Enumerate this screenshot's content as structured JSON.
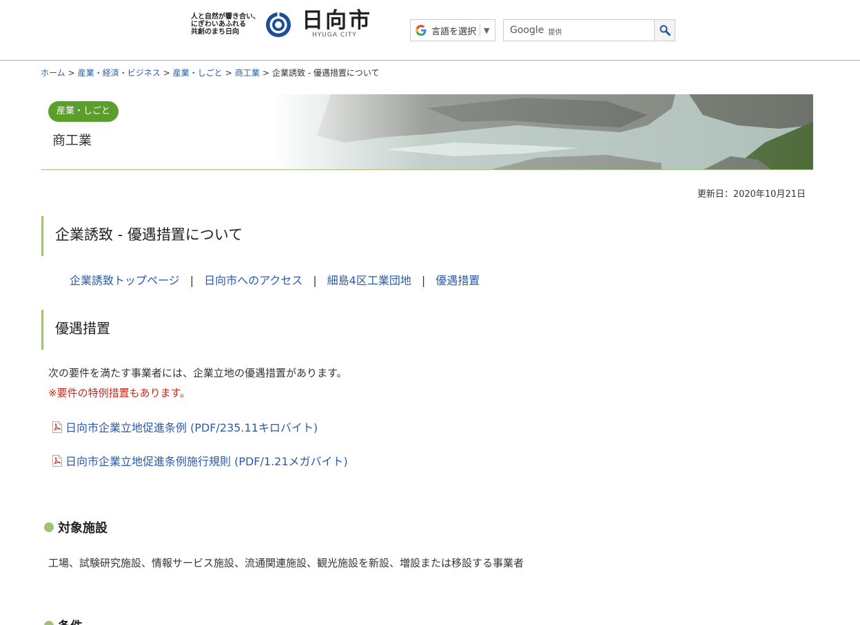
{
  "header": {
    "tagline": "人と自然が響き合い、\nにぎわいあふれる\n共創のまち日向",
    "logo_text": "日向市",
    "logo_sub": "HYUGA CITY",
    "translate_label": "言語を選択",
    "translate_caret": "▼",
    "search_brand": "Google",
    "search_provided": "提供"
  },
  "breadcrumb": {
    "items": [
      "ホーム",
      "産業・経済・ビジネス",
      "産業・しごと",
      "商工業"
    ],
    "current": "企業誘致 - 優遇措置について",
    "separator": ">"
  },
  "banner": {
    "category": "産業・しごと",
    "title": "商工業"
  },
  "updated": "更新日：2020年10月21日",
  "page_title": "企業誘致 - 優遇措置について",
  "subnav": {
    "items": [
      "企業誘致トップページ",
      "日向市へのアクセス",
      "細島4区工業団地",
      "優遇措置"
    ],
    "separator": "|"
  },
  "section_title": "優遇措置",
  "intro": "次の要件を満たす事業者には、企業立地の優遇措置があります。",
  "note": "※要件の特例措置もあります。",
  "pdf_links": [
    "日向市企業立地促進条例 (PDF/235.11キロバイト)",
    "日向市企業立地促進条例施行規則 (PDF/1.21メガバイト)"
  ],
  "subsections": [
    {
      "title": "対象施設",
      "body": "工場、試験研究施設、情報サービス施設、流通関連施設、観光施設を新設、増設または移設する事業者"
    },
    {
      "title": "条件",
      "body": ""
    }
  ],
  "colors": {
    "accent_green": "#9fc27a",
    "pill_green": "#5a9e2c",
    "link_blue": "#2a5aa8",
    "note_red": "#d0271d"
  }
}
